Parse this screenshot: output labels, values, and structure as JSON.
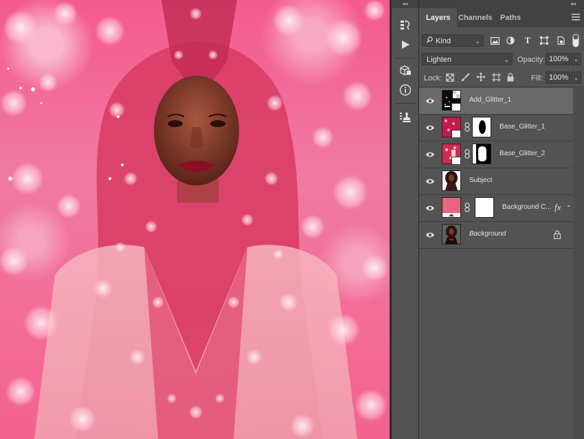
{
  "panel": {
    "tabs": [
      {
        "label": "Layers"
      },
      {
        "label": "Channels"
      },
      {
        "label": "Paths"
      }
    ],
    "filter": {
      "kind_label": "Kind"
    },
    "blend_mode": "Lighten",
    "opacity_label": "Opacity:",
    "opacity_value": "100%",
    "lock_label": "Lock:",
    "fill_label": "Fill:",
    "fill_value": "100%",
    "layers": [
      {
        "name": "Add_Glitter_1",
        "selected": true
      },
      {
        "name": "Base_Glitter_1"
      },
      {
        "name": "Base_Glitter_2"
      },
      {
        "name": "Subject"
      },
      {
        "name": "Background C...",
        "fx": "fx"
      },
      {
        "name": "Background",
        "locked": true
      }
    ]
  },
  "colors": {
    "accent_pink": "#f0567f",
    "panel_bg": "#535353",
    "selected_row": "#696969"
  },
  "icons": [
    "history-icon",
    "play-icon",
    "3d-icon",
    "info-icon",
    "clone-source-icon",
    "search-icon",
    "image-filter-icon",
    "adjustment-filter-icon",
    "type-filter-icon",
    "shape-filter-icon",
    "smart-object-filter-icon",
    "filter-toggle-icon",
    "lock-transparent-icon",
    "lock-paint-icon",
    "lock-move-icon",
    "lock-artboard-icon",
    "lock-all-icon",
    "eye-icon",
    "chain-icon",
    "lock-icon",
    "panel-menu-icon"
  ]
}
